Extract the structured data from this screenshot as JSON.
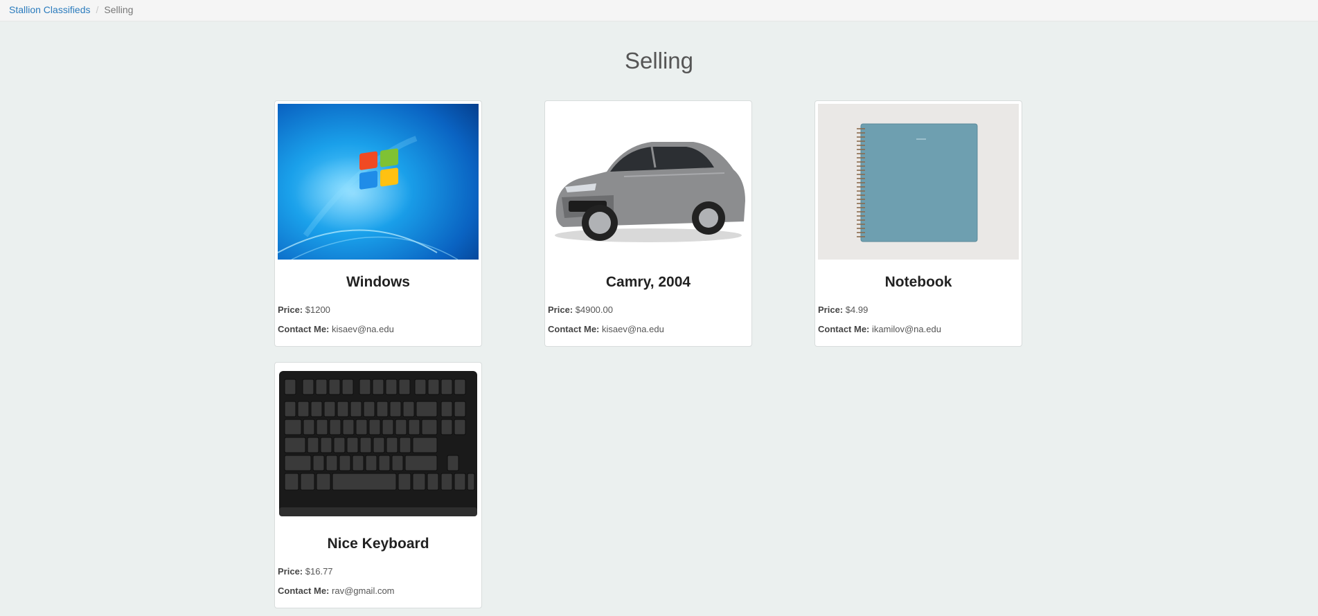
{
  "breadcrumb": {
    "home": "Stallion Classifieds",
    "current": "Selling"
  },
  "page": {
    "title": "Selling"
  },
  "listings": [
    {
      "title": "Windows",
      "price_label": "Price:",
      "price": "$1200",
      "contact_label": "Contact Me:",
      "contact": "kisaev@na.edu",
      "image": "windows-wallpaper"
    },
    {
      "title": "Camry, 2004",
      "price_label": "Price:",
      "price": "$4900.00",
      "contact_label": "Contact Me:",
      "contact": "kisaev@na.edu",
      "image": "silver-sedan-car"
    },
    {
      "title": "Notebook",
      "price_label": "Price:",
      "price": "$4.99",
      "contact_label": "Contact Me:",
      "contact": "ikamilov@na.edu",
      "image": "blue-spiral-notebook"
    },
    {
      "title": "Nice Keyboard",
      "price_label": "Price:",
      "price": "$16.77",
      "contact_label": "Contact Me:",
      "contact": "rav@gmail.com",
      "image": "black-keyboard"
    }
  ],
  "colors": {
    "background": "#ebf0ef",
    "link": "#2a7bbd",
    "card": "#ffffff"
  }
}
